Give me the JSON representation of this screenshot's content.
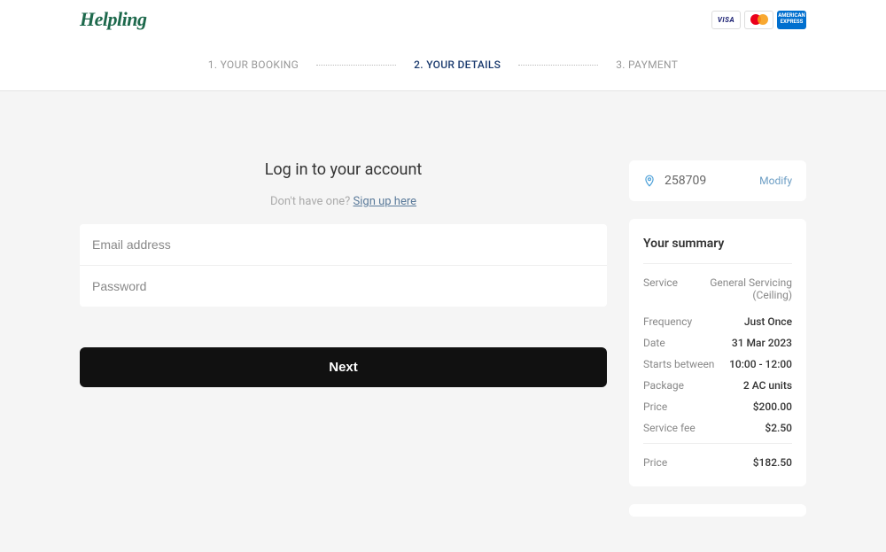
{
  "brand": "Helpling",
  "payment_methods": {
    "visa": "VISA",
    "amex": "AMERICAN EXPRESS"
  },
  "steps": {
    "s1": "1. YOUR BOOKING",
    "s2": "2. YOUR DETAILS",
    "s3": "3. PAYMENT"
  },
  "login": {
    "title": "Log in to your account",
    "no_account": "Don't have one? ",
    "signup": "Sign up here",
    "email_placeholder": "Email address",
    "password_placeholder": "Password",
    "next": "Next"
  },
  "postcode": {
    "value": "258709",
    "modify": "Modify"
  },
  "summary": {
    "title": "Your summary",
    "rows": {
      "service": {
        "label": "Service",
        "value": "General Servicing (Ceiling)"
      },
      "frequency": {
        "label": "Frequency",
        "value": "Just Once"
      },
      "date": {
        "label": "Date",
        "value": "31 Mar 2023"
      },
      "starts": {
        "label": "Starts between",
        "value": "10:00 - 12:00"
      },
      "package": {
        "label": "Package",
        "value": "2 AC units"
      },
      "price": {
        "label": "Price",
        "value": "$200.00"
      },
      "fee": {
        "label": "Service fee",
        "value": "$2.50"
      },
      "total": {
        "label": "Price",
        "value": "$182.50"
      }
    }
  }
}
